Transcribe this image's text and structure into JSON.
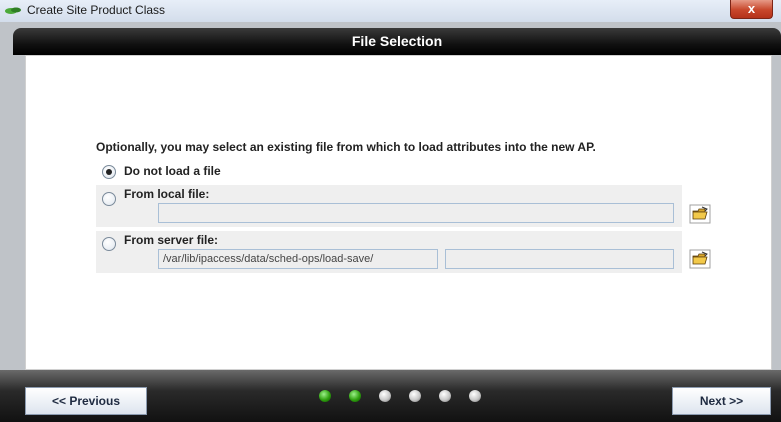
{
  "window": {
    "title": "Create Site Product Class",
    "close_glyph": "x"
  },
  "header": {
    "title": "File Selection"
  },
  "content": {
    "prompt": "Optionally, you may select an existing file from which to load attributes into the new AP.",
    "options": [
      {
        "label": "Do not load a file",
        "selected": true
      },
      {
        "label": "From local file:",
        "selected": false
      },
      {
        "label": "From server file:",
        "selected": false
      }
    ],
    "local_file": {
      "value": ""
    },
    "server_file": {
      "path": "/var/lib/ipaccess/data/sched-ops/load-save/",
      "value": ""
    }
  },
  "footer": {
    "previous_label": "<< Previous",
    "next_label": "Next >>",
    "steps": {
      "total": 6,
      "completed": 2
    }
  },
  "icons": {
    "app": "leaf-icon",
    "close": "close-icon",
    "browse": "open-folder-icon"
  },
  "colors": {
    "header_bg": "#000000",
    "step_active": "#2fa10e",
    "step_inactive": "#c9c9c9"
  }
}
